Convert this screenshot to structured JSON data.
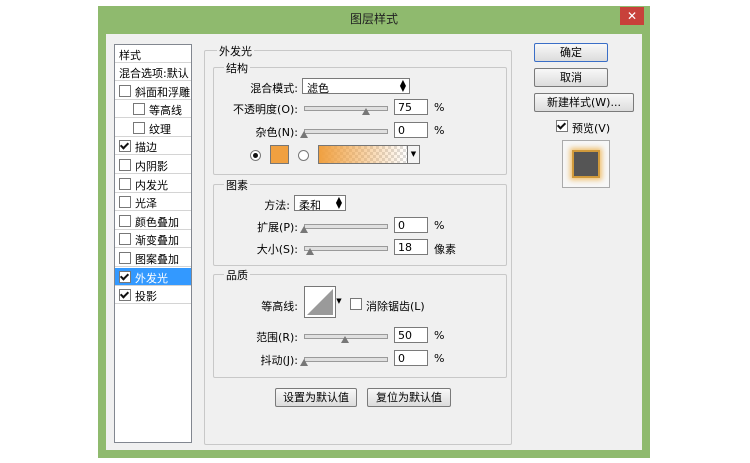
{
  "window": {
    "title": "图层样式",
    "close_glyph": "✕"
  },
  "sidebar": {
    "header": "样式",
    "items": [
      {
        "label": "混合选项:默认",
        "checkbox": false,
        "checked": false,
        "indent": 0,
        "selected": false
      },
      {
        "label": "斜面和浮雕",
        "checkbox": true,
        "checked": false,
        "indent": 0,
        "selected": false
      },
      {
        "label": "等高线",
        "checkbox": true,
        "checked": false,
        "indent": 1,
        "selected": false
      },
      {
        "label": "纹理",
        "checkbox": true,
        "checked": false,
        "indent": 1,
        "selected": false
      },
      {
        "label": "描边",
        "checkbox": true,
        "checked": true,
        "indent": 0,
        "selected": false
      },
      {
        "label": "内阴影",
        "checkbox": true,
        "checked": false,
        "indent": 0,
        "selected": false
      },
      {
        "label": "内发光",
        "checkbox": true,
        "checked": false,
        "indent": 0,
        "selected": false
      },
      {
        "label": "光泽",
        "checkbox": true,
        "checked": false,
        "indent": 0,
        "selected": false
      },
      {
        "label": "颜色叠加",
        "checkbox": true,
        "checked": false,
        "indent": 0,
        "selected": false
      },
      {
        "label": "渐变叠加",
        "checkbox": true,
        "checked": false,
        "indent": 0,
        "selected": false
      },
      {
        "label": "图案叠加",
        "checkbox": true,
        "checked": false,
        "indent": 0,
        "selected": false
      },
      {
        "label": "外发光",
        "checkbox": true,
        "checked": true,
        "indent": 0,
        "selected": true
      },
      {
        "label": "投影",
        "checkbox": true,
        "checked": true,
        "indent": 0,
        "selected": false
      }
    ]
  },
  "panel": {
    "title": "外发光",
    "structure": {
      "title": "结构",
      "blend_mode_label": "混合模式:",
      "blend_mode_value": "滤色",
      "opacity_label": "不透明度(O):",
      "opacity_value": "75",
      "opacity_unit": "%",
      "noise_label": "杂色(N):",
      "noise_value": "0",
      "noise_unit": "%",
      "color_hex": "#f0a040"
    },
    "elements": {
      "title": "图素",
      "technique_label": "方法:",
      "technique_value": "柔和",
      "spread_label": "扩展(P):",
      "spread_value": "0",
      "spread_unit": "%",
      "size_label": "大小(S):",
      "size_value": "18",
      "size_unit": "像素"
    },
    "quality": {
      "title": "品质",
      "contour_label": "等高线:",
      "antialias_label": "消除锯齿(L)",
      "range_label": "范围(R):",
      "range_value": "50",
      "range_unit": "%",
      "jitter_label": "抖动(J):",
      "jitter_value": "0",
      "jitter_unit": "%"
    },
    "make_default_label": "设置为默认值",
    "reset_default_label": "复位为默认值"
  },
  "actions": {
    "ok_label": "确定",
    "cancel_label": "取消",
    "new_style_label": "新建样式(W)...",
    "preview_label": "预览(V)",
    "preview_checked": true
  },
  "sliders": {
    "opacity": 0.75,
    "noise": 0,
    "spread": 0,
    "size": 0.072,
    "range": 0.5,
    "jitter": 0
  }
}
